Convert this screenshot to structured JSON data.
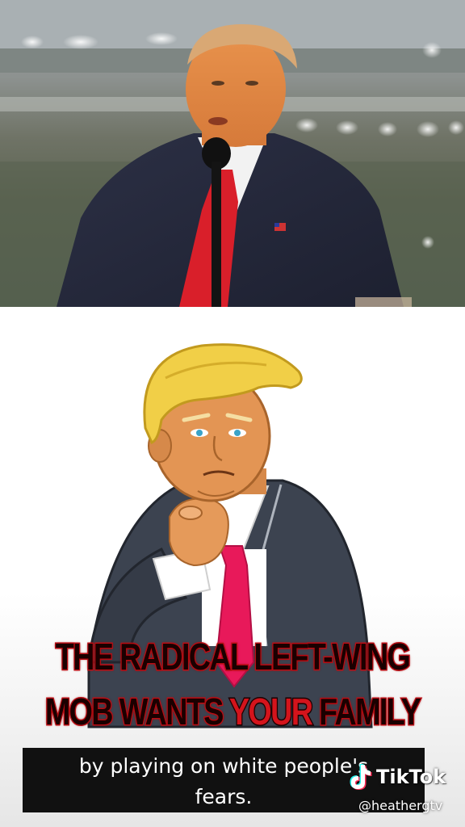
{
  "headline": {
    "line1": "THE RADICAL LEFT-WING",
    "line2_part1": "MOB WANTS ",
    "line2_accent": "YOUR",
    "line2_part2": " FAMILY"
  },
  "caption": {
    "line1": "by playing on white people's",
    "line2": "fears."
  },
  "watermark": {
    "brand": "TikTok",
    "handle": "@heathergtv",
    "icon": "tiktok-logo-icon"
  },
  "colors": {
    "headline_red": "#d4141c",
    "headline_dark": "#1a0000",
    "caption_bg": "#111111",
    "tie_red": "#d91f2a",
    "cartoon_tie": "#e8195a"
  }
}
